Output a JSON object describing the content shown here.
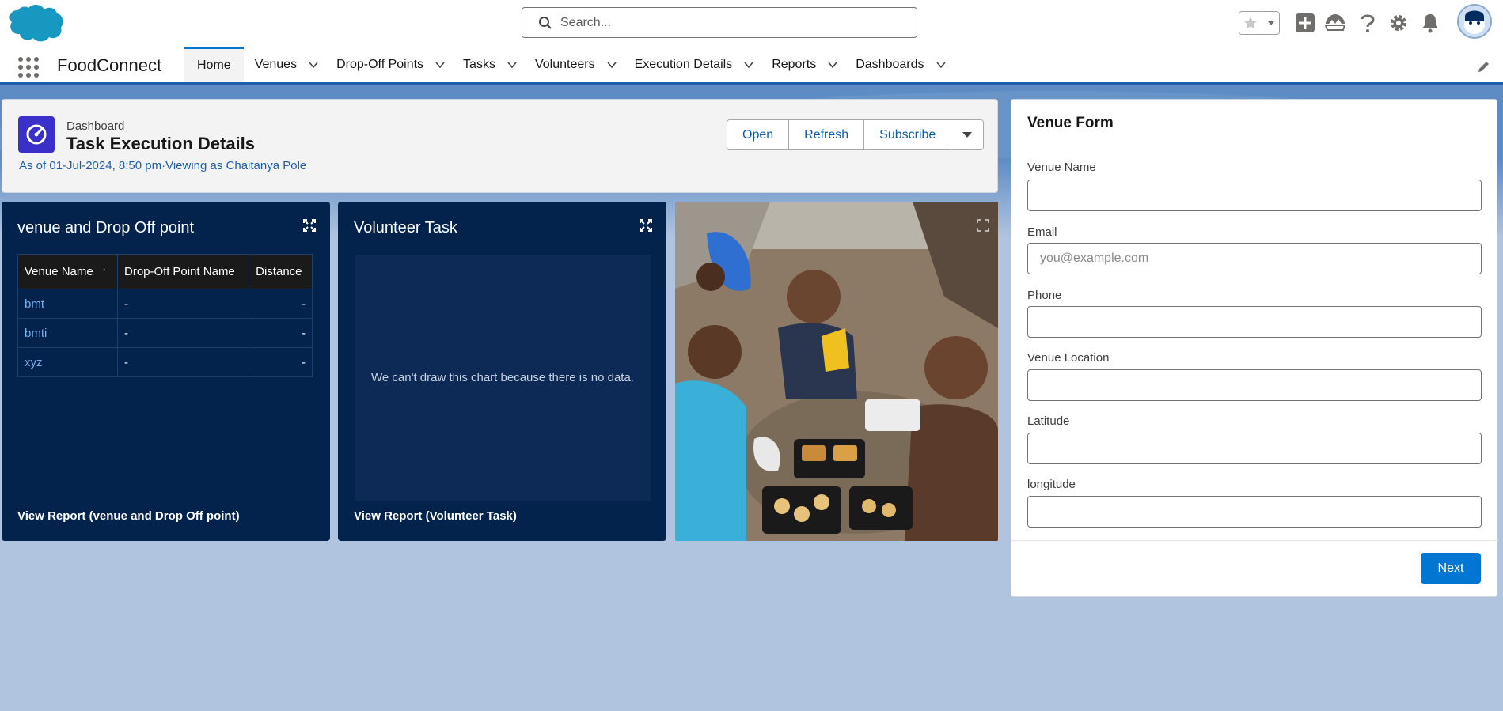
{
  "header": {
    "search_placeholder": "Search...",
    "icons": [
      "salesforce-cloud-logo",
      "search-icon",
      "star-icon",
      "chevron-down-icon",
      "add-icon",
      "trailhead-icon",
      "help-icon",
      "gear-icon",
      "bell-icon",
      "avatar"
    ]
  },
  "nav": {
    "app_name": "FoodConnect",
    "tabs": [
      {
        "label": "Home",
        "active": true
      },
      {
        "label": "Venues"
      },
      {
        "label": "Drop-Off Points"
      },
      {
        "label": "Tasks"
      },
      {
        "label": "Volunteers"
      },
      {
        "label": "Execution Details"
      },
      {
        "label": "Reports"
      },
      {
        "label": "Dashboards"
      }
    ]
  },
  "dashboard": {
    "kicker": "Dashboard",
    "title": "Task Execution Details",
    "meta": "As of 01-Jul-2024, 8:50 pm·Viewing as Chaitanya Pole",
    "buttons": {
      "open": "Open",
      "refresh": "Refresh",
      "subscribe": "Subscribe"
    }
  },
  "widgets": {
    "venue_dropoff": {
      "title": "venue and Drop Off point",
      "columns": [
        "Venue Name",
        "Drop-Off Point Name",
        "Distance"
      ],
      "sort_indicator": "↑",
      "rows": [
        [
          "bmt",
          "-",
          "-"
        ],
        [
          "bmti",
          "-",
          "-"
        ],
        [
          "xyz",
          "-",
          "-"
        ]
      ],
      "footer": "View Report (venue and Drop Off point)"
    },
    "volunteer_task": {
      "title": "Volunteer Task",
      "empty_message": "We can't draw this chart because there is no data.",
      "footer": "View Report (Volunteer Task)"
    }
  },
  "venue_form": {
    "title": "Venue Form",
    "fields": [
      {
        "label": "Venue Name",
        "placeholder": "",
        "value": ""
      },
      {
        "label": "Email",
        "placeholder": "you@example.com",
        "value": ""
      },
      {
        "label": "Phone",
        "placeholder": "",
        "value": ""
      },
      {
        "label": "Venue Location",
        "placeholder": "",
        "value": ""
      },
      {
        "label": "Latitude",
        "placeholder": "",
        "value": ""
      },
      {
        "label": "longitude",
        "placeholder": "",
        "value": ""
      }
    ],
    "next_label": "Next"
  },
  "colors": {
    "brand_blue": "#0176d3",
    "widget_bg": "#03234d",
    "page_bg": "#b0c4df",
    "link": "#0b5cab"
  }
}
